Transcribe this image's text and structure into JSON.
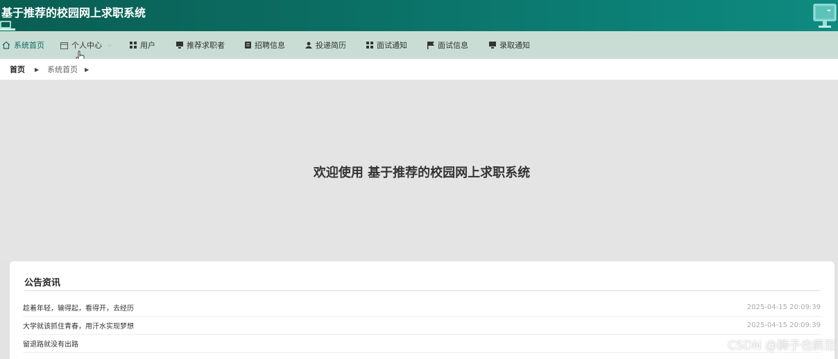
{
  "header": {
    "title": "基于推荐的校园网上求职系统"
  },
  "nav": {
    "items": [
      {
        "label": "系统首页",
        "icon": "home-icon"
      },
      {
        "label": "个人中心",
        "icon": "calendar-icon"
      },
      {
        "label": "用户",
        "icon": "grid-icon"
      },
      {
        "label": "推荐求职者",
        "icon": "monitor-icon"
      },
      {
        "label": "招聘信息",
        "icon": "document-icon"
      },
      {
        "label": "投递简历",
        "icon": "user-icon"
      },
      {
        "label": "面试通知",
        "icon": "grid-icon"
      },
      {
        "label": "面试信息",
        "icon": "flag-icon"
      },
      {
        "label": "录取通知",
        "icon": "monitor-icon"
      }
    ]
  },
  "breadcrumb": {
    "home": "首页",
    "current": "系统首页"
  },
  "welcome": {
    "text": "欢迎使用 基于推荐的校园网上求职系统"
  },
  "notice": {
    "title": "公告资讯",
    "items": [
      {
        "title": "趁着年轻，输得起，看得开，去经历",
        "date": "2025-04-15 20:09:39"
      },
      {
        "title": "大学就该抓住青春，用汗水实现梦想",
        "date": "2025-04-15 20:09:39"
      },
      {
        "title": "留退路就没有出路",
        "date": ""
      }
    ]
  },
  "watermark": {
    "text": "CSDN @狮子也疯狂"
  },
  "colors": {
    "header_start": "#0a5e52",
    "header_end": "#0e8b80",
    "nav_bg": "#c9ddd5",
    "active": "#0b6e64"
  }
}
